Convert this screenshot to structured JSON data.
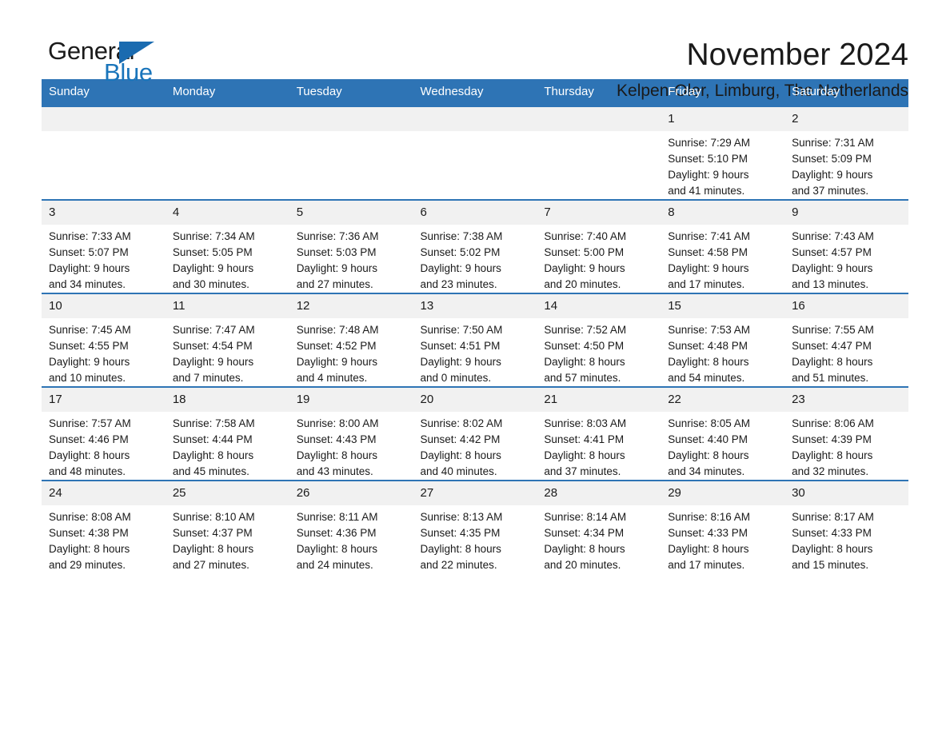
{
  "brand": {
    "name_part1": "General",
    "name_part2": "Blue",
    "triangle_icon": "triangle-icon",
    "color_black": "#1b1b1b",
    "color_blue": "#1a75bb"
  },
  "header": {
    "month_title": "November 2024",
    "location": "Kelpen-Oler, Limburg, The Netherlands"
  },
  "theme": {
    "header_blue": "#2e74b5",
    "daynum_gray": "#f1f1f1",
    "text": "#1a1a1a"
  },
  "calendar": {
    "weekday_headers": [
      "Sunday",
      "Monday",
      "Tuesday",
      "Wednesday",
      "Thursday",
      "Friday",
      "Saturday"
    ],
    "weeks": [
      [
        {
          "day": "",
          "sunrise": "",
          "sunset": "",
          "daylight1": "",
          "daylight2": ""
        },
        {
          "day": "",
          "sunrise": "",
          "sunset": "",
          "daylight1": "",
          "daylight2": ""
        },
        {
          "day": "",
          "sunrise": "",
          "sunset": "",
          "daylight1": "",
          "daylight2": ""
        },
        {
          "day": "",
          "sunrise": "",
          "sunset": "",
          "daylight1": "",
          "daylight2": ""
        },
        {
          "day": "",
          "sunrise": "",
          "sunset": "",
          "daylight1": "",
          "daylight2": ""
        },
        {
          "day": "1",
          "sunrise": "Sunrise: 7:29 AM",
          "sunset": "Sunset: 5:10 PM",
          "daylight1": "Daylight: 9 hours",
          "daylight2": "and 41 minutes."
        },
        {
          "day": "2",
          "sunrise": "Sunrise: 7:31 AM",
          "sunset": "Sunset: 5:09 PM",
          "daylight1": "Daylight: 9 hours",
          "daylight2": "and 37 minutes."
        }
      ],
      [
        {
          "day": "3",
          "sunrise": "Sunrise: 7:33 AM",
          "sunset": "Sunset: 5:07 PM",
          "daylight1": "Daylight: 9 hours",
          "daylight2": "and 34 minutes."
        },
        {
          "day": "4",
          "sunrise": "Sunrise: 7:34 AM",
          "sunset": "Sunset: 5:05 PM",
          "daylight1": "Daylight: 9 hours",
          "daylight2": "and 30 minutes."
        },
        {
          "day": "5",
          "sunrise": "Sunrise: 7:36 AM",
          "sunset": "Sunset: 5:03 PM",
          "daylight1": "Daylight: 9 hours",
          "daylight2": "and 27 minutes."
        },
        {
          "day": "6",
          "sunrise": "Sunrise: 7:38 AM",
          "sunset": "Sunset: 5:02 PM",
          "daylight1": "Daylight: 9 hours",
          "daylight2": "and 23 minutes."
        },
        {
          "day": "7",
          "sunrise": "Sunrise: 7:40 AM",
          "sunset": "Sunset: 5:00 PM",
          "daylight1": "Daylight: 9 hours",
          "daylight2": "and 20 minutes."
        },
        {
          "day": "8",
          "sunrise": "Sunrise: 7:41 AM",
          "sunset": "Sunset: 4:58 PM",
          "daylight1": "Daylight: 9 hours",
          "daylight2": "and 17 minutes."
        },
        {
          "day": "9",
          "sunrise": "Sunrise: 7:43 AM",
          "sunset": "Sunset: 4:57 PM",
          "daylight1": "Daylight: 9 hours",
          "daylight2": "and 13 minutes."
        }
      ],
      [
        {
          "day": "10",
          "sunrise": "Sunrise: 7:45 AM",
          "sunset": "Sunset: 4:55 PM",
          "daylight1": "Daylight: 9 hours",
          "daylight2": "and 10 minutes."
        },
        {
          "day": "11",
          "sunrise": "Sunrise: 7:47 AM",
          "sunset": "Sunset: 4:54 PM",
          "daylight1": "Daylight: 9 hours",
          "daylight2": "and 7 minutes."
        },
        {
          "day": "12",
          "sunrise": "Sunrise: 7:48 AM",
          "sunset": "Sunset: 4:52 PM",
          "daylight1": "Daylight: 9 hours",
          "daylight2": "and 4 minutes."
        },
        {
          "day": "13",
          "sunrise": "Sunrise: 7:50 AM",
          "sunset": "Sunset: 4:51 PM",
          "daylight1": "Daylight: 9 hours",
          "daylight2": "and 0 minutes."
        },
        {
          "day": "14",
          "sunrise": "Sunrise: 7:52 AM",
          "sunset": "Sunset: 4:50 PM",
          "daylight1": "Daylight: 8 hours",
          "daylight2": "and 57 minutes."
        },
        {
          "day": "15",
          "sunrise": "Sunrise: 7:53 AM",
          "sunset": "Sunset: 4:48 PM",
          "daylight1": "Daylight: 8 hours",
          "daylight2": "and 54 minutes."
        },
        {
          "day": "16",
          "sunrise": "Sunrise: 7:55 AM",
          "sunset": "Sunset: 4:47 PM",
          "daylight1": "Daylight: 8 hours",
          "daylight2": "and 51 minutes."
        }
      ],
      [
        {
          "day": "17",
          "sunrise": "Sunrise: 7:57 AM",
          "sunset": "Sunset: 4:46 PM",
          "daylight1": "Daylight: 8 hours",
          "daylight2": "and 48 minutes."
        },
        {
          "day": "18",
          "sunrise": "Sunrise: 7:58 AM",
          "sunset": "Sunset: 4:44 PM",
          "daylight1": "Daylight: 8 hours",
          "daylight2": "and 45 minutes."
        },
        {
          "day": "19",
          "sunrise": "Sunrise: 8:00 AM",
          "sunset": "Sunset: 4:43 PM",
          "daylight1": "Daylight: 8 hours",
          "daylight2": "and 43 minutes."
        },
        {
          "day": "20",
          "sunrise": "Sunrise: 8:02 AM",
          "sunset": "Sunset: 4:42 PM",
          "daylight1": "Daylight: 8 hours",
          "daylight2": "and 40 minutes."
        },
        {
          "day": "21",
          "sunrise": "Sunrise: 8:03 AM",
          "sunset": "Sunset: 4:41 PM",
          "daylight1": "Daylight: 8 hours",
          "daylight2": "and 37 minutes."
        },
        {
          "day": "22",
          "sunrise": "Sunrise: 8:05 AM",
          "sunset": "Sunset: 4:40 PM",
          "daylight1": "Daylight: 8 hours",
          "daylight2": "and 34 minutes."
        },
        {
          "day": "23",
          "sunrise": "Sunrise: 8:06 AM",
          "sunset": "Sunset: 4:39 PM",
          "daylight1": "Daylight: 8 hours",
          "daylight2": "and 32 minutes."
        }
      ],
      [
        {
          "day": "24",
          "sunrise": "Sunrise: 8:08 AM",
          "sunset": "Sunset: 4:38 PM",
          "daylight1": "Daylight: 8 hours",
          "daylight2": "and 29 minutes."
        },
        {
          "day": "25",
          "sunrise": "Sunrise: 8:10 AM",
          "sunset": "Sunset: 4:37 PM",
          "daylight1": "Daylight: 8 hours",
          "daylight2": "and 27 minutes."
        },
        {
          "day": "26",
          "sunrise": "Sunrise: 8:11 AM",
          "sunset": "Sunset: 4:36 PM",
          "daylight1": "Daylight: 8 hours",
          "daylight2": "and 24 minutes."
        },
        {
          "day": "27",
          "sunrise": "Sunrise: 8:13 AM",
          "sunset": "Sunset: 4:35 PM",
          "daylight1": "Daylight: 8 hours",
          "daylight2": "and 22 minutes."
        },
        {
          "day": "28",
          "sunrise": "Sunrise: 8:14 AM",
          "sunset": "Sunset: 4:34 PM",
          "daylight1": "Daylight: 8 hours",
          "daylight2": "and 20 minutes."
        },
        {
          "day": "29",
          "sunrise": "Sunrise: 8:16 AM",
          "sunset": "Sunset: 4:33 PM",
          "daylight1": "Daylight: 8 hours",
          "daylight2": "and 17 minutes."
        },
        {
          "day": "30",
          "sunrise": "Sunrise: 8:17 AM",
          "sunset": "Sunset: 4:33 PM",
          "daylight1": "Daylight: 8 hours",
          "daylight2": "and 15 minutes."
        }
      ]
    ]
  }
}
